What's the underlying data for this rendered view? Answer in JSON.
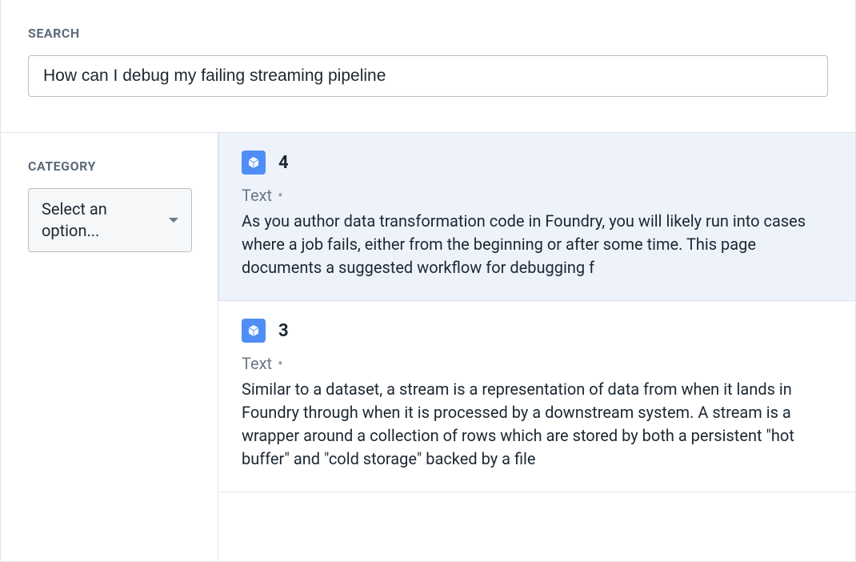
{
  "search": {
    "label": "SEARCH",
    "value": "How can I debug my failing streaming pipeline"
  },
  "sidebar": {
    "category_label": "CATEGORY",
    "dropdown_text": "Select an option..."
  },
  "results": [
    {
      "number": "4",
      "type": "Text",
      "body": "As you author data transformation code in Foundry, you will likely run into cases where a job fails, either from the beginning or after some time. This page documents a suggested workflow for debugging f",
      "selected": true
    },
    {
      "number": "3",
      "type": "Text",
      "body": "Similar to a dataset, a stream is a representation of data from when it lands in Foundry through when it is processed by a downstream system. A stream is a wrapper around a collection of rows which are stored by both a persistent \"hot buffer\" and \"cold storage\" backed by a file",
      "selected": false
    }
  ]
}
